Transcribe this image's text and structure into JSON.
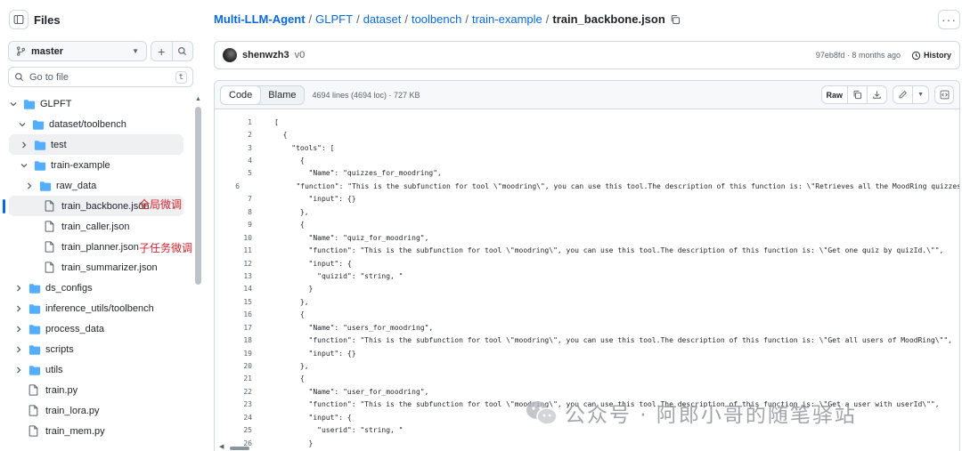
{
  "sidebar": {
    "title": "Files",
    "branch": "master",
    "search_placeholder": "Go to file",
    "search_shortcut": "t",
    "tree": [
      {
        "label": "GLPFT",
        "type": "folder",
        "open": true
      },
      {
        "label": "dataset/toolbench",
        "type": "folder",
        "open": true
      },
      {
        "label": "test",
        "type": "folder",
        "open": false
      },
      {
        "label": "train-example",
        "type": "folder",
        "open": true
      },
      {
        "label": "raw_data",
        "type": "folder",
        "open": false
      },
      {
        "label": "train_backbone.json",
        "type": "file",
        "selected": true
      },
      {
        "label": "train_caller.json",
        "type": "file"
      },
      {
        "label": "train_planner.json",
        "type": "file"
      },
      {
        "label": "train_summarizer.json",
        "type": "file"
      },
      {
        "label": "ds_configs",
        "type": "folder",
        "open": false
      },
      {
        "label": "inference_utils/toolbench",
        "type": "folder",
        "open": false
      },
      {
        "label": "process_data",
        "type": "folder",
        "open": false
      },
      {
        "label": "scripts",
        "type": "folder",
        "open": false
      },
      {
        "label": "utils",
        "type": "folder",
        "open": false
      },
      {
        "label": "train.py",
        "type": "file"
      },
      {
        "label": "train_lora.py",
        "type": "file"
      },
      {
        "label": "train_mem.py",
        "type": "file"
      }
    ],
    "annotations": {
      "backbone_note": "全局微调",
      "subtask_note": "子任务微调"
    }
  },
  "breadcrumb": {
    "repo": "Multi-LLM-Agent",
    "parts": [
      "GLPFT",
      "dataset",
      "toolbench",
      "train-example"
    ],
    "current": "train_backbone.json"
  },
  "commit": {
    "author": "shenwzh3",
    "message": "v0",
    "hash_time": "97eb8fd · 8 months ago",
    "history_label": "History"
  },
  "file": {
    "tab_code": "Code",
    "tab_blame": "Blame",
    "info": "4694 lines (4694 loc) · 727 KB",
    "raw_label": "Raw"
  },
  "code_lines": [
    {
      "n": "1",
      "t": "["
    },
    {
      "n": "2",
      "t": "  {"
    },
    {
      "n": "3",
      "t": "    \"tools\": ["
    },
    {
      "n": "4",
      "t": "      {"
    },
    {
      "n": "5",
      "t": "        \"Name\": \"quizzes_for_moodring\","
    },
    {
      "n": "6",
      "t": "        \"function\": \"This is the subfunction for tool \\\"moodring\\\", you can use this tool.The description of this function is: \\\"Retrieves all the MoodRing quizzes"
    },
    {
      "n": "7",
      "t": "        \"input\": {}"
    },
    {
      "n": "8",
      "t": "      },"
    },
    {
      "n": "9",
      "t": "      {"
    },
    {
      "n": "10",
      "t": "        \"Name\": \"quiz_for_moodring\","
    },
    {
      "n": "11",
      "t": "        \"function\": \"This is the subfunction for tool \\\"moodring\\\", you can use this tool.The description of this function is: \\\"Get one quiz by quizId.\\\"\","
    },
    {
      "n": "12",
      "t": "        \"input\": {"
    },
    {
      "n": "13",
      "t": "          \"quizid\": \"string, \""
    },
    {
      "n": "14",
      "t": "        }"
    },
    {
      "n": "15",
      "t": "      },"
    },
    {
      "n": "16",
      "t": "      {"
    },
    {
      "n": "17",
      "t": "        \"Name\": \"users_for_moodring\","
    },
    {
      "n": "18",
      "t": "        \"function\": \"This is the subfunction for tool \\\"moodring\\\", you can use this tool.The description of this function is: \\\"Get all users of MoodRing\\\"\","
    },
    {
      "n": "19",
      "t": "        \"input\": {}"
    },
    {
      "n": "20",
      "t": "      },"
    },
    {
      "n": "21",
      "t": "      {"
    },
    {
      "n": "22",
      "t": "        \"Name\": \"user_for_moodring\","
    },
    {
      "n": "23",
      "t": "        \"function\": \"This is the subfunction for tool \\\"moodring\\\", you can use this tool.The description of this function is: \\\"Get a user with userId\\\"\","
    },
    {
      "n": "24",
      "t": "        \"input\": {"
    },
    {
      "n": "25",
      "t": "          \"userid\": \"string, \""
    },
    {
      "n": "26",
      "t": "        }"
    }
  ],
  "watermark": "公众号 · 阿郎小哥的随笔驿站",
  "colors": {
    "link": "#0969da",
    "note": "#d1242f",
    "folder": "#54aeff",
    "border": "#d1d9e0"
  }
}
